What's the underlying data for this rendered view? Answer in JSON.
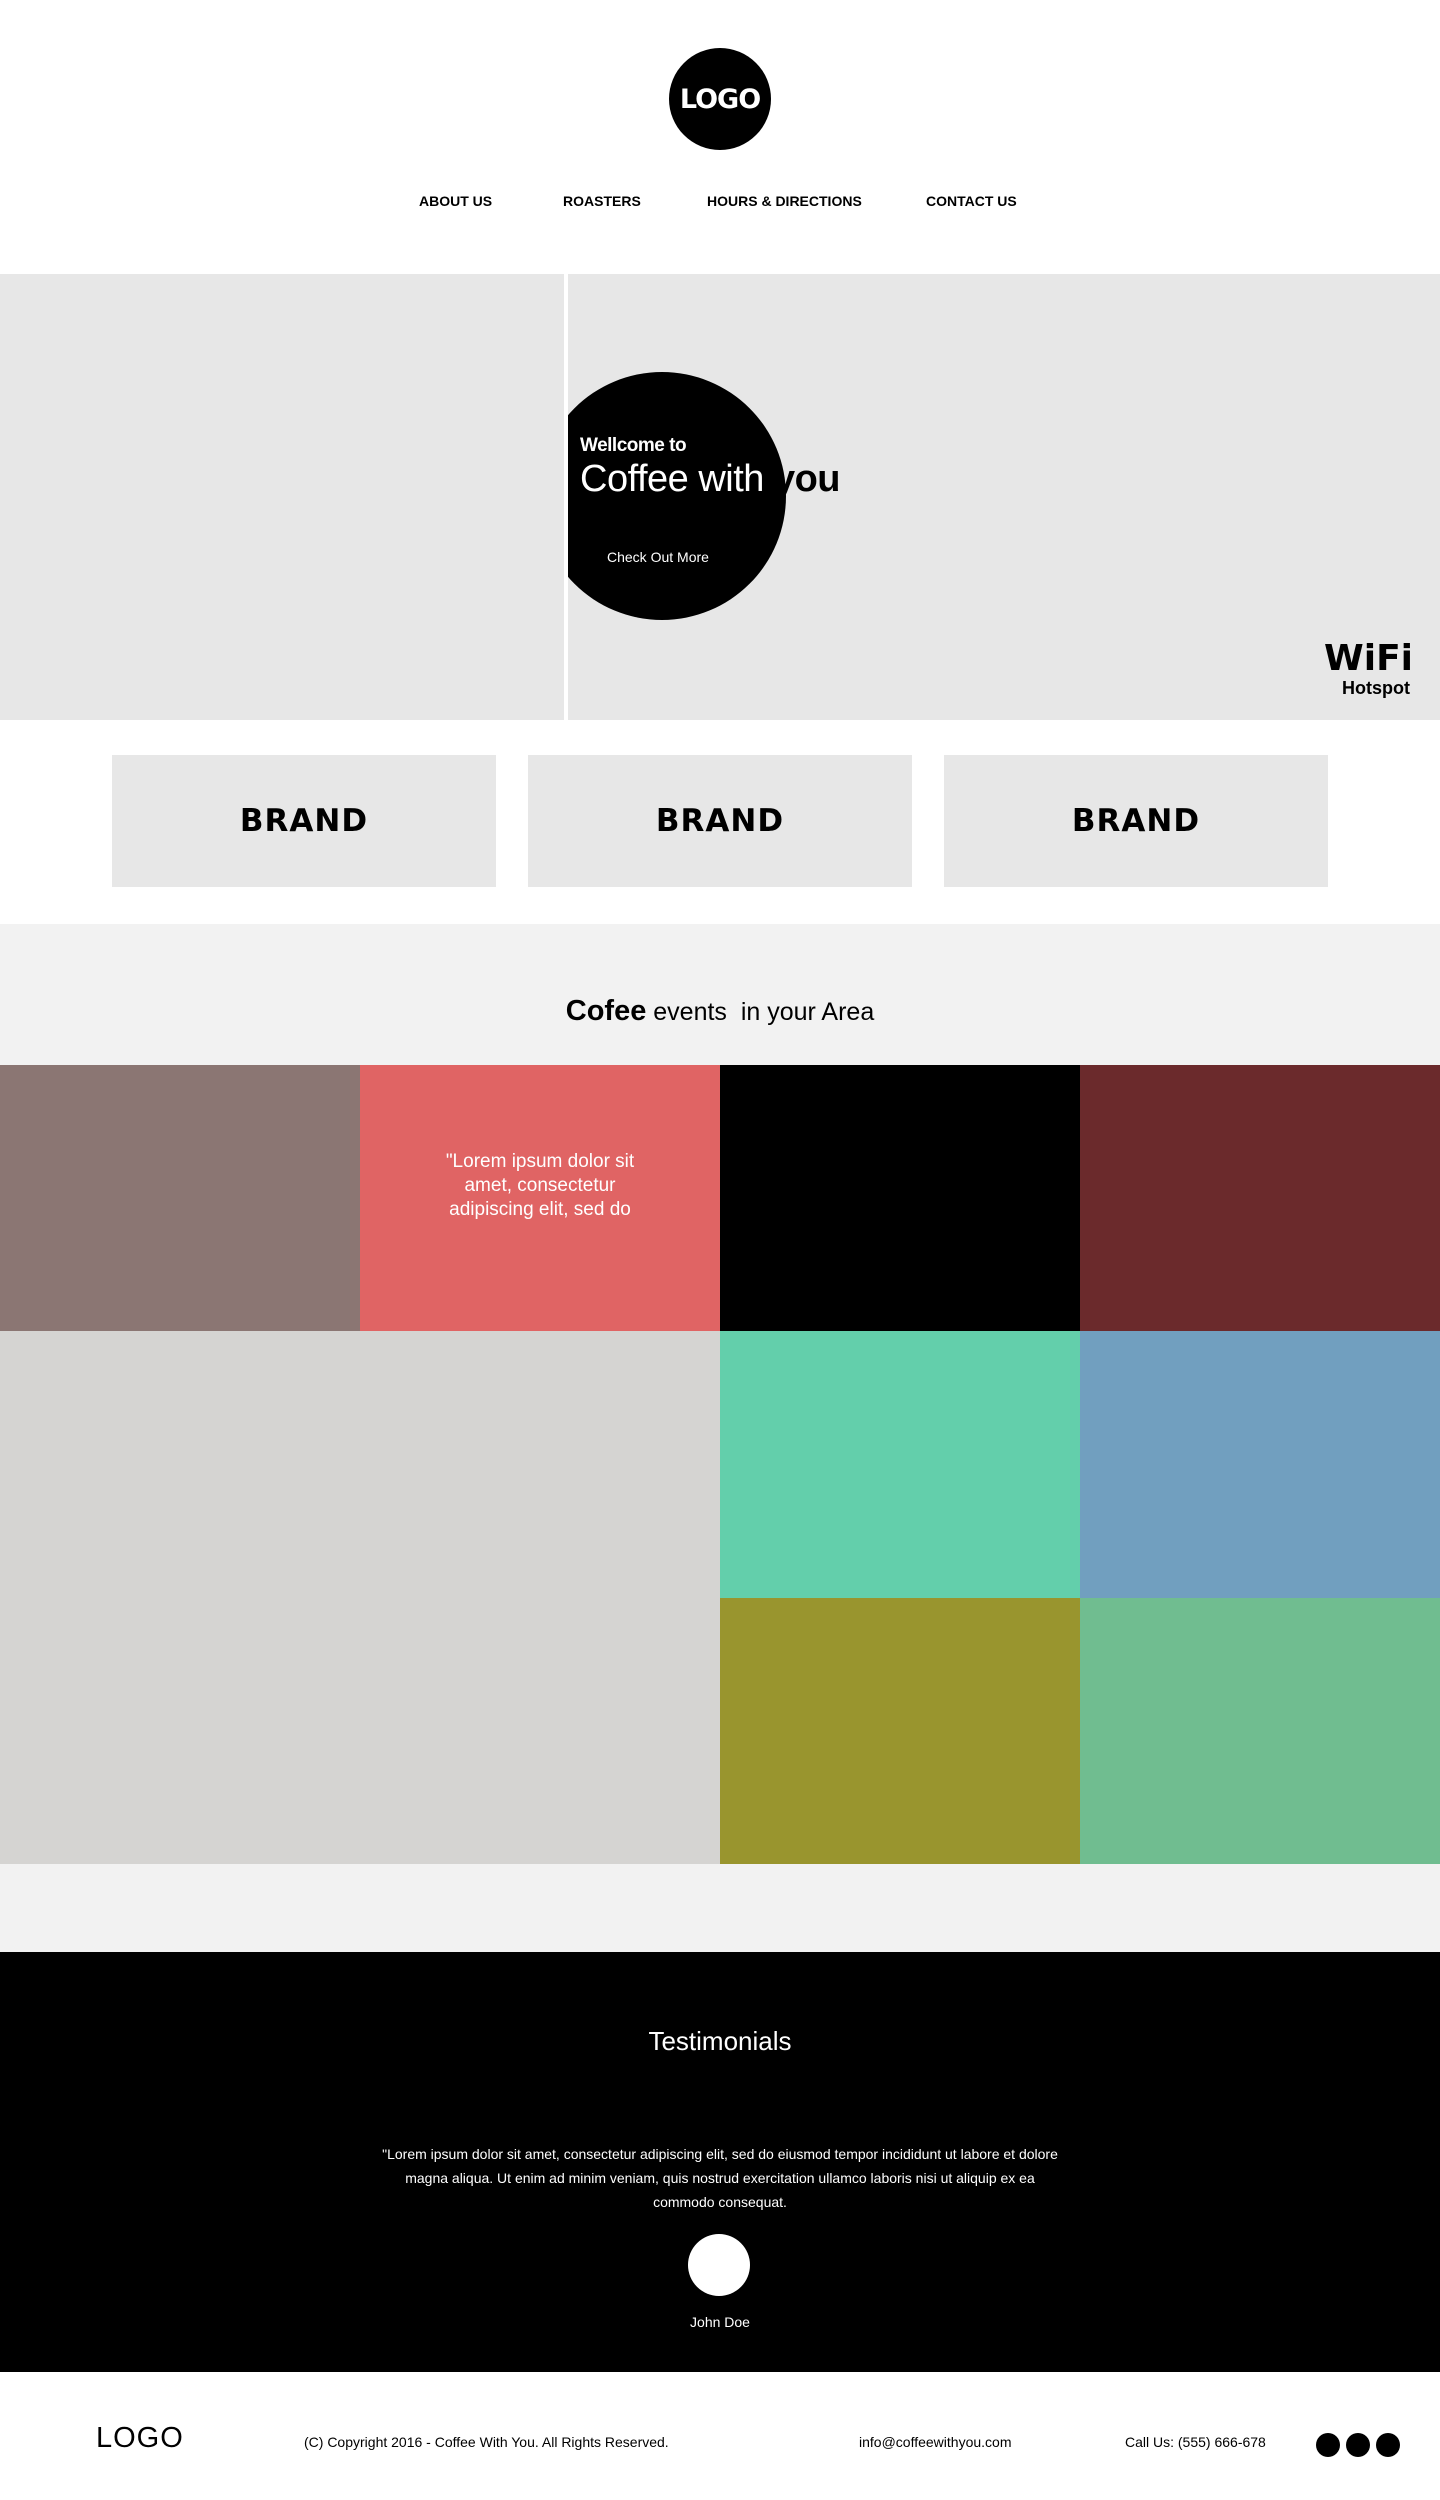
{
  "header": {
    "logo": "LOGO",
    "nav": [
      "ABOUT US",
      "ROASTERS",
      "HOURS & DIRECTIONS",
      "CONTACT US"
    ]
  },
  "hero": {
    "welcome": "Wellcome to",
    "title_white": "Coffee with",
    "title_black": " you",
    "cta": "Check Out More",
    "wifi_title": "WiFi",
    "wifi_sub": "Hotspot"
  },
  "brands": [
    "BRAND",
    "BRAND",
    "BRAND"
  ],
  "events": {
    "title_strong": "Cofee",
    "title_rest": " events  in your Area",
    "quote": "\"Lorem ipsum dolor sit amet, consectetur adipiscing elit, sed do",
    "tile_colors": [
      "#8b7673",
      "#e06464",
      "#000000",
      "#6b2a2c",
      "#d5d4d2",
      "#63cfab",
      "#719fbf",
      "#99952e",
      "#70bd90"
    ]
  },
  "testimonials": {
    "title": "Testimonials",
    "quote": "\"Lorem ipsum dolor sit amet, consectetur adipiscing elit, sed do eiusmod tempor incididunt ut labore et dolore magna aliqua. Ut enim ad minim veniam, quis nostrud exercitation ullamco laboris nisi ut aliquip ex ea commodo consequat.",
    "name": "John Doe"
  },
  "footer": {
    "logo": "LOGO",
    "copyright": "(C) Copyright 2016 - Coffee With You. All Rights Reserved.",
    "email": "info@coffeewithyou.com",
    "phone": "Call Us: (555) 666-678"
  }
}
